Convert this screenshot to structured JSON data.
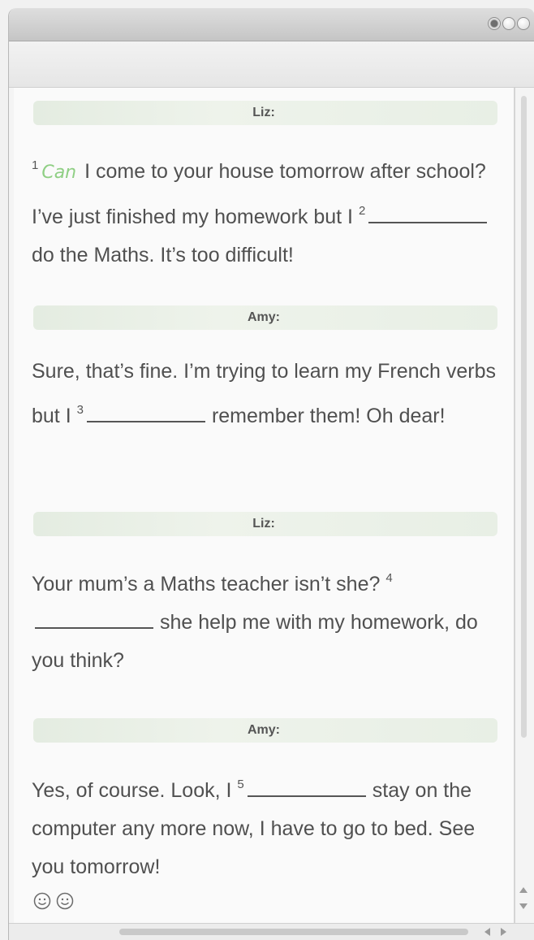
{
  "window": {
    "controls": [
      "close",
      "minimize",
      "zoom"
    ]
  },
  "messages": [
    {
      "speaker": "Liz:",
      "segments": [
        {
          "type": "num",
          "text": "1"
        },
        {
          "type": "answer",
          "text": "Can"
        },
        {
          "type": "text",
          "text": "I come to your house tomorrow after school? I’ve just finished my homework but I "
        },
        {
          "type": "num",
          "text": "2"
        },
        {
          "type": "blank"
        },
        {
          "type": "text",
          "text": "do the Maths. It’s too difficult!"
        }
      ]
    },
    {
      "speaker": "Amy:",
      "segments": [
        {
          "type": "text",
          "text": "Sure, that’s fine. I’m trying to learn my French verbs but I "
        },
        {
          "type": "num",
          "text": "3"
        },
        {
          "type": "blank"
        },
        {
          "type": "text",
          "text": "remember them! Oh dear!"
        }
      ]
    },
    {
      "speaker": "Liz:",
      "segments": [
        {
          "type": "text",
          "text": "Your mum’s a Maths teacher isn’t she? "
        },
        {
          "type": "num",
          "text": "4"
        },
        {
          "type": "blank"
        },
        {
          "type": "text",
          "text": "she help me with my homework, do you think?"
        }
      ]
    },
    {
      "speaker": "Amy:",
      "segments": [
        {
          "type": "text",
          "text": "Yes, of course. Look, I "
        },
        {
          "type": "num",
          "text": "5"
        },
        {
          "type": "blank"
        },
        {
          "type": "text",
          "text": "stay on the computer any more now, I have to go to bed. See you tomorrow!"
        }
      ]
    }
  ],
  "emoji_icons": [
    "smiley-icon",
    "smiley-icon"
  ],
  "colors": {
    "answer": "#8fcf84",
    "speaker_bar": "#e8efe5",
    "text": "#505050"
  }
}
